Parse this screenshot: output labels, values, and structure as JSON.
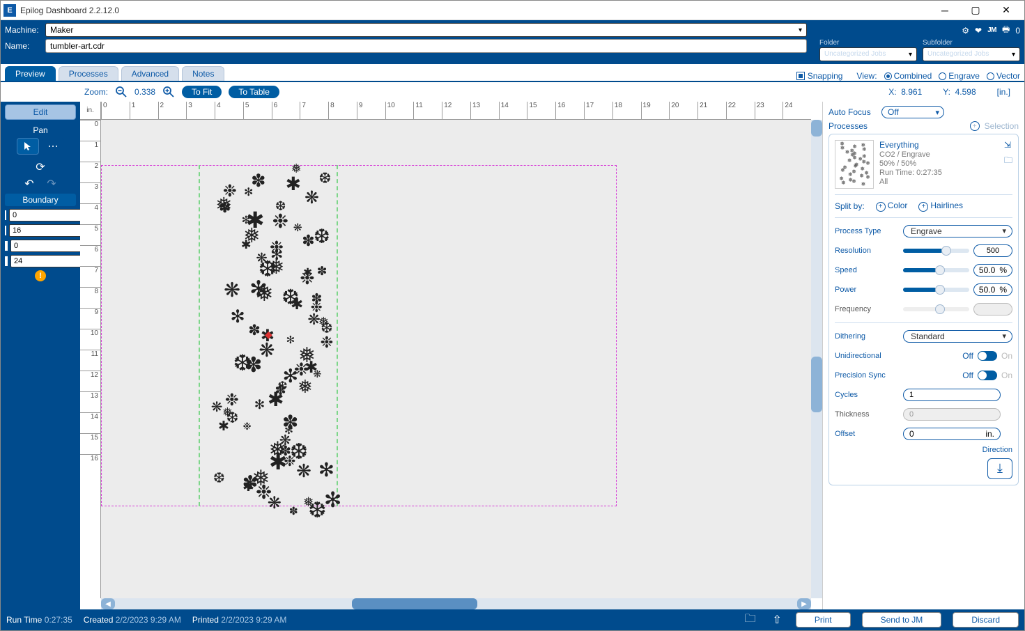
{
  "title": "Epilog Dashboard 2.2.12.0",
  "logo_letter": "E",
  "machbar": {
    "machine_label": "Machine:",
    "machine_value": "Maker",
    "name_label": "Name:",
    "name_value": "tumbler-art.cdr",
    "folder_label": "Folder",
    "folder_value": "Uncategorized Jobs",
    "subfolder_label": "Subfolder",
    "subfolder_value": "Uncategorized Jobs",
    "printer_count": "0"
  },
  "tabs": {
    "preview": "Preview",
    "processes": "Processes",
    "advanced": "Advanced",
    "notes": "Notes"
  },
  "snapping_label": "Snapping",
  "view": {
    "label": "View:",
    "combined": "Combined",
    "engrave": "Engrave",
    "vector": "Vector"
  },
  "zoom": {
    "label": "Zoom:",
    "value": "0.338",
    "to_fit": "To Fit",
    "to_table": "To Table",
    "x_label": "X:",
    "x_value": "8.961",
    "y_label": "Y:",
    "y_value": "4.598",
    "unit": "[in.]"
  },
  "ruler": {
    "unit": "in.",
    "h": [
      "0",
      "1",
      "2",
      "3",
      "4",
      "5",
      "6",
      "7",
      "8",
      "9",
      "10",
      "11",
      "12",
      "13",
      "14",
      "15",
      "16",
      "17",
      "18",
      "19",
      "20",
      "21",
      "22",
      "23",
      "24"
    ],
    "v": [
      "0",
      "1",
      "2",
      "3",
      "4",
      "5",
      "6",
      "7",
      "8",
      "9",
      "10",
      "11",
      "12",
      "13",
      "14",
      "15",
      "16"
    ]
  },
  "left": {
    "edit": "Edit",
    "pan": "Pan",
    "boundary": "Boundary",
    "b_top": "0",
    "b_height": "16",
    "b_left": "0",
    "b_width": "24"
  },
  "right": {
    "autofocus_label": "Auto Focus",
    "autofocus_value": "Off",
    "processes_hdr": "Processes",
    "selection": "Selection",
    "proc_name": "Everything",
    "proc_type": "CO2 / Engrave",
    "proc_sp": "50% / 50%",
    "proc_runtime": "Run Time: 0:27:35",
    "proc_all": "All",
    "split_label": "Split by:",
    "split_color": "Color",
    "split_hairlines": "Hairlines",
    "process_type_label": "Process Type",
    "process_type_value": "Engrave",
    "resolution_label": "Resolution",
    "resolution_value": "500",
    "speed_label": "Speed",
    "speed_value": "50.0",
    "power_label": "Power",
    "power_value": "50.0",
    "pct": "%",
    "frequency_label": "Frequency",
    "dithering_label": "Dithering",
    "dithering_value": "Standard",
    "unidir_label": "Unidirectional",
    "precsync_label": "Precision Sync",
    "off": "Off",
    "on": "On",
    "cycles_label": "Cycles",
    "cycles_value": "1",
    "thickness_label": "Thickness",
    "thickness_value": "0",
    "offset_label": "Offset",
    "offset_value": "0",
    "offset_unit": "in.",
    "direction_label": "Direction"
  },
  "footer": {
    "runtime_label": "Run Time",
    "runtime_value": "0:27:35",
    "created_label": "Created",
    "created_value": "2/2/2023 9:29 AM",
    "printed_label": "Printed",
    "printed_value": "2/2/2023 9:29 AM",
    "print": "Print",
    "sendjm": "Send to JM",
    "discard": "Discard"
  }
}
